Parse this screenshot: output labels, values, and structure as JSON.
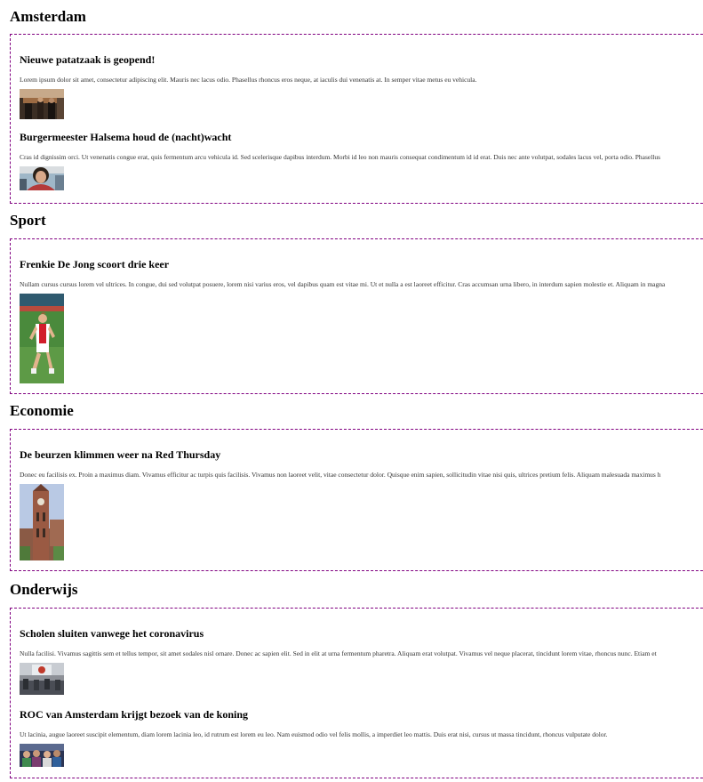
{
  "sections": {
    "amsterdam": {
      "title": "Amsterdam",
      "articles": [
        {
          "title": "Nieuwe patatzaak is geopend!",
          "body": "Lorem ipsum dolor sit amet, consectetur adipiscing elit. Mauris nec lacus odio. Phasellus rhoncus eros neque, at iaculis dui venenatis at. In semper vitae metus eu vehicula."
        },
        {
          "title": "Burgermeester Halsema houd de (nacht)wacht",
          "body": "Cras id dignissim orci. Ut venenatis congue erat, quis fermentum arcu vehicula id. Sed scelerisque dapibus interdum. Morbi id leo non mauris consequat condimentum id id erat. Duis nec ante volutpat, sodales lacus vel, porta odio. Phasellus"
        }
      ]
    },
    "sport": {
      "title": "Sport",
      "articles": [
        {
          "title": "Frenkie De Jong scoort drie keer",
          "body": "Nullam cursus cursus lorem vel ultrices. In congue, dui sed volutpat posuere, lorem nisi varius eros, vel dapibus quam est vitae mi. Ut et nulla a est laoreet efficitur. Cras accumsan urna libero, in interdum sapien molestie et. Aliquam in magna"
        }
      ]
    },
    "economie": {
      "title": "Economie",
      "articles": [
        {
          "title": "De beurzen klimmen weer na Red Thursday",
          "body": "Donec eu facilisis ex. Proin a maximus diam. Vivamus efficitur ac turpis quis facilisis. Vivamus non laoreet velit, vitae consectetur dolor. Quisque enim sapien, sollicitudin vitae nisi quis, ultrices pretium felis. Aliquam malesuada maximus h"
        }
      ]
    },
    "onderwijs": {
      "title": "Onderwijs",
      "articles": [
        {
          "title": "Scholen sluiten vanwege het coronavirus",
          "body": "Nulla facilisi. Vivamus sagittis sem et tellus tempor, sit amet sodales nisl ornare. Donec ac sapien elit. Sed in elit at urna fermentum pharetra. Aliquam erat volutpat. Vivamus vel neque placerat, tincidunt lorem vitae, rhoncus nunc. Etiam et"
        },
        {
          "title": "ROC van Amsterdam krijgt bezoek van de koning",
          "body": "Ut lacinia, augue laoreet suscipit elementum, diam lorem lacinia leo, id rutrum est lorem eu leo. Nam euismod odio vel felis mollis, a imperdiet leo mattis. Duis erat nisi, cursus ut massa tincidunt, rhoncus vulputate dolor."
        }
      ]
    }
  }
}
